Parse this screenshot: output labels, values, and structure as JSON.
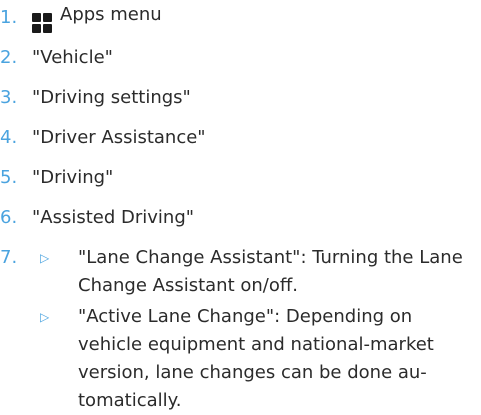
{
  "steps": [
    {
      "number": "1.",
      "icon": "apps-menu-icon",
      "text": "Apps menu"
    },
    {
      "number": "2.",
      "text": "\"Vehicle\""
    },
    {
      "number": "3.",
      "text": "\"Driving settings\""
    },
    {
      "number": "4.",
      "text": "\"Driver Assistance\""
    },
    {
      "number": "5.",
      "text": "\"Driving\""
    },
    {
      "number": "6.",
      "text": "\"Assisted Driving\""
    },
    {
      "number": "7."
    }
  ],
  "bullets": [
    {
      "marker": "▷",
      "text": "\"Lane Change Assistant\": Turning the Lane Change Assistant on/off."
    },
    {
      "marker": "▷",
      "text": "\"Active Lane Change\": Depending on vehicle equipment and national-market version, lane changes can be done au-tomatically."
    }
  ],
  "colors": {
    "number_accent": "#4aa3df",
    "text": "#2b2b2b",
    "icon": "#1a1a1a"
  }
}
